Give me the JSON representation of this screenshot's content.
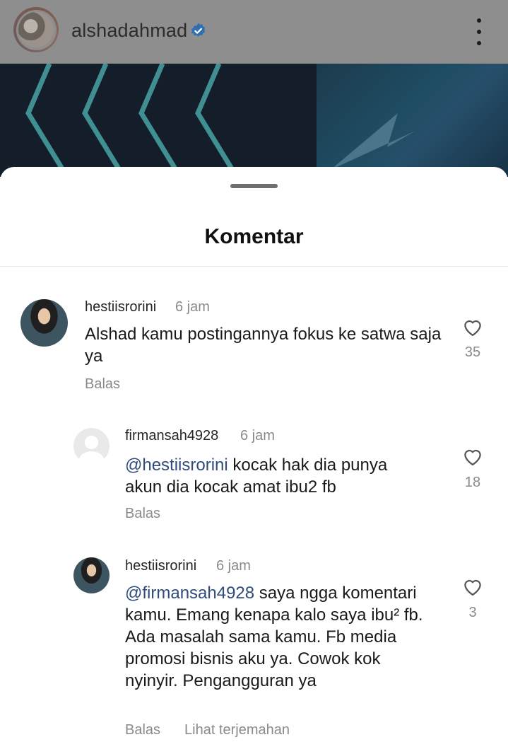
{
  "header": {
    "username": "alshadahmad",
    "verified_icon": "verified-badge-icon",
    "menu_icon": "more-vertical-icon"
  },
  "sheet": {
    "title": "Komentar"
  },
  "comments": [
    {
      "user": "hestiisrorini",
      "time": "6 jam",
      "text": "Alshad kamu postingannya fokus ke satwa saja ya",
      "reply": "Balas",
      "likes": "35"
    },
    {
      "user": "firmansah4928",
      "time": "6 jam",
      "mention": "@hestiisrorini",
      "text": " kocak hak dia punya akun dia kocak amat ibu2 fb",
      "reply": "Balas",
      "likes": "18"
    },
    {
      "user": "hestiisrorini",
      "time": "6 jam",
      "mention": "@firmansah4928",
      "text": " saya ngga komentari kamu. Emang kenapa kalo saya ibu² fb. Ada masalah sama kamu. Fb media promosi bisnis aku ya. Cowok kok nyinyir. Pengangguran ya",
      "reply": "Balas",
      "translate": "Lihat terjemahan",
      "likes": "3"
    }
  ],
  "colors": {
    "mention": "#2f4b7c",
    "verified": "#3897f0",
    "secondary_text": "#8a8a8a"
  }
}
